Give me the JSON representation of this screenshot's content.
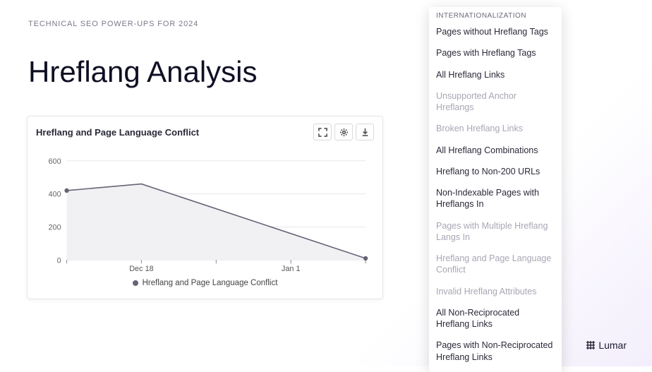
{
  "eyebrow": "TECHNICAL SEO POWER-UPS FOR 2024",
  "title": "Hreflang Analysis",
  "chart": {
    "title": "Hreflang and Page Language Conflict",
    "legend": "Hreflang and Page Language Conflict"
  },
  "chart_data": {
    "type": "line",
    "title": "Hreflang and Page Language Conflict",
    "xlabel": "",
    "ylabel": "",
    "ylim": [
      0,
      600
    ],
    "x": [
      "",
      "Dec 18",
      "",
      "Jan 1",
      ""
    ],
    "values": [
      420,
      460,
      null,
      null,
      10
    ],
    "y_ticks": [
      0,
      200,
      400,
      600
    ]
  },
  "panel": {
    "heading": "INTERNATIONALIZATION",
    "items": [
      {
        "label": "Pages without Hreflang Tags",
        "disabled": false
      },
      {
        "label": "Pages with Hreflang Tags",
        "disabled": false
      },
      {
        "label": "All Hreflang Links",
        "disabled": false
      },
      {
        "label": "Unsupported Anchor Hreflangs",
        "disabled": true
      },
      {
        "label": "Broken Hreflang Links",
        "disabled": true
      },
      {
        "label": "All Hreflang Combinations",
        "disabled": false
      },
      {
        "label": "Hreflang to Non-200 URLs",
        "disabled": false
      },
      {
        "label": "Non-Indexable Pages with Hreflangs In",
        "disabled": false
      },
      {
        "label": "Pages with Multiple Hreflang Langs In",
        "disabled": true
      },
      {
        "label": "Hreflang and Page Language Conflict",
        "disabled": true
      },
      {
        "label": "Invalid Hreflang Attributes",
        "disabled": true
      },
      {
        "label": "All Non-Reciprocated Hreflang Links",
        "disabled": false
      },
      {
        "label": "Pages with Non-Reciprocated Hreflang Links",
        "disabled": false
      }
    ]
  },
  "brand": "Lumar"
}
